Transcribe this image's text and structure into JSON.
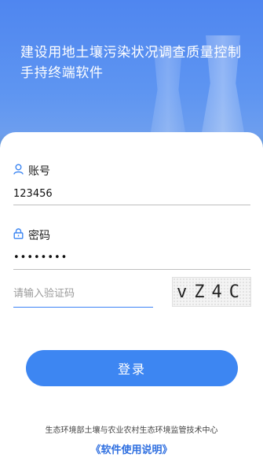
{
  "header": {
    "title": "建设用地土壤污染状况调查质量控制手持终端软件"
  },
  "login": {
    "account_label": "账号",
    "account_value": "123456",
    "password_label": "密码",
    "password_value": "••••••••",
    "captcha_placeholder": "请输入验证码",
    "captcha_code": "vZ4C",
    "login_button": "登录"
  },
  "footer": {
    "org": "生态环境部土壤与农业农村生态环境监管技术中心",
    "manual_link": "《软件使用说明》"
  },
  "icons": {
    "account": "user-icon",
    "password": "lock-icon"
  },
  "colors": {
    "accent": "#3d86f2",
    "header_bg": "#5e95f1"
  }
}
